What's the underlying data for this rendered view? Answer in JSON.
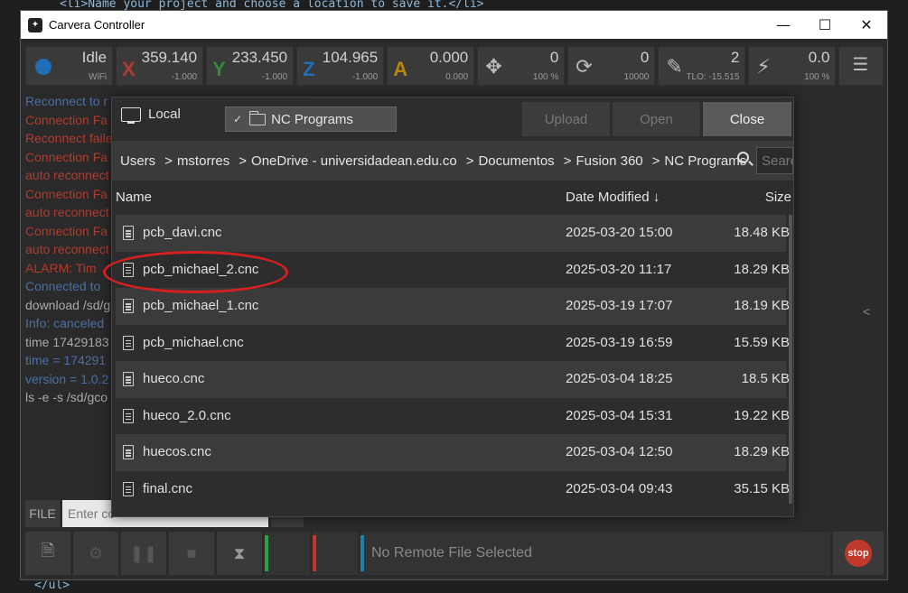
{
  "background_code": {
    "top": "<li>Name your project and choose a location to save it.</li>",
    "bottom": "</ul>"
  },
  "window": {
    "title": "Carvera Controller",
    "controls": [
      "—",
      "☐",
      "✕"
    ]
  },
  "toolbar": {
    "status": {
      "value": "Idle",
      "sub": "WiFi"
    },
    "x": {
      "axis": "X",
      "value": "359.140",
      "sub": "-1.000",
      "color": "#b33a2e"
    },
    "y": {
      "axis": "Y",
      "value": "233.450",
      "sub": "-1.000",
      "color": "#2e8b3a"
    },
    "z": {
      "axis": "Z",
      "value": "104.965",
      "sub": "-1.000",
      "color": "#1e6fb8"
    },
    "a": {
      "axis": "A",
      "value": "0.000",
      "sub": "0.000",
      "color": "#b8860b"
    },
    "feed": {
      "value": "0",
      "sub": "100 %"
    },
    "spindle": {
      "value": "0",
      "sub": "10000"
    },
    "tool": {
      "value": "2",
      "sub": "TLO: -15.515"
    },
    "laser": {
      "value": "0.0",
      "sub": "100 %"
    }
  },
  "console": {
    "lines": [
      {
        "text": "Reconnect to r",
        "color": "blue"
      },
      {
        "text": "Connection Fa",
        "color": "red"
      },
      {
        "text": "Reconnect faile",
        "color": "red"
      },
      {
        "text": "Connection Fa",
        "color": "red"
      },
      {
        "text": "auto reconnect",
        "color": "red"
      },
      {
        "text": "Connection Fa",
        "color": "red"
      },
      {
        "text": "auto reconnect",
        "color": "red"
      },
      {
        "text": "Connection Fa",
        "color": "red"
      },
      {
        "text": "auto reconnect",
        "color": "red"
      },
      {
        "text": "ALARM: Tim",
        "color": "red"
      },
      {
        "text": "Connected to",
        "color": "blue"
      },
      {
        "text": "download /sd/g",
        "color": "gray"
      },
      {
        "text": "Info: canceled",
        "color": "blue"
      },
      {
        "text": "time 17429183",
        "color": "gray"
      },
      {
        "text": "time = 174291",
        "color": "blue"
      },
      {
        "text": "version = 1.0.2",
        "color": "blue"
      },
      {
        "text": "ls -e -s /sd/gco",
        "color": "gray"
      }
    ],
    "cmd_label": "FILE",
    "cmd_placeholder": "Enter co"
  },
  "bottombar": {
    "file_status": "No Remote File Selected",
    "stop_label": "stop"
  },
  "dialog": {
    "location": "Local",
    "folder": "NC Programs",
    "buttons": {
      "upload": "Upload",
      "open": "Open",
      "close": "Close"
    },
    "breadcrumb": [
      "Users",
      "mstorres",
      "OneDrive - universidadean.edu.co",
      "Documentos",
      "Fusion 360",
      "NC Programs"
    ],
    "search_placeholder": "Search",
    "columns": {
      "name": "Name",
      "date": "Date Modified ↓",
      "size": "Size"
    },
    "files": [
      {
        "name": "pcb_davi.cnc",
        "date": "2025-03-20 15:00",
        "size": "18.48 KB"
      },
      {
        "name": "pcb_michael_2.cnc",
        "date": "2025-03-20 11:17",
        "size": "18.29 KB"
      },
      {
        "name": "pcb_michael_1.cnc",
        "date": "2025-03-19 17:07",
        "size": "18.19 KB"
      },
      {
        "name": "pcb_michael.cnc",
        "date": "2025-03-19 16:59",
        "size": "15.59 KB"
      },
      {
        "name": "hueco.cnc",
        "date": "2025-03-04 18:25",
        "size": "18.5 KB"
      },
      {
        "name": "hueco_2.0.cnc",
        "date": "2025-03-04 15:31",
        "size": "19.22 KB"
      },
      {
        "name": "huecos.cnc",
        "date": "2025-03-04 12:50",
        "size": "18.29 KB"
      },
      {
        "name": "final.cnc",
        "date": "2025-03-04 09:43",
        "size": "35.15 KB"
      }
    ]
  }
}
